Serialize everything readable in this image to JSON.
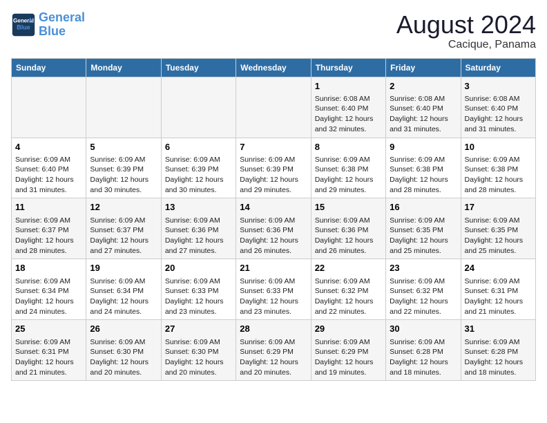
{
  "header": {
    "logo_line1": "General",
    "logo_line2": "Blue",
    "main_title": "August 2024",
    "subtitle": "Cacique, Panama"
  },
  "days_of_week": [
    "Sunday",
    "Monday",
    "Tuesday",
    "Wednesday",
    "Thursday",
    "Friday",
    "Saturday"
  ],
  "weeks": [
    [
      {
        "day": "",
        "detail": ""
      },
      {
        "day": "",
        "detail": ""
      },
      {
        "day": "",
        "detail": ""
      },
      {
        "day": "",
        "detail": ""
      },
      {
        "day": "1",
        "detail": "Sunrise: 6:08 AM\nSunset: 6:40 PM\nDaylight: 12 hours\nand 32 minutes."
      },
      {
        "day": "2",
        "detail": "Sunrise: 6:08 AM\nSunset: 6:40 PM\nDaylight: 12 hours\nand 31 minutes."
      },
      {
        "day": "3",
        "detail": "Sunrise: 6:08 AM\nSunset: 6:40 PM\nDaylight: 12 hours\nand 31 minutes."
      }
    ],
    [
      {
        "day": "4",
        "detail": "Sunrise: 6:09 AM\nSunset: 6:40 PM\nDaylight: 12 hours\nand 31 minutes."
      },
      {
        "day": "5",
        "detail": "Sunrise: 6:09 AM\nSunset: 6:39 PM\nDaylight: 12 hours\nand 30 minutes."
      },
      {
        "day": "6",
        "detail": "Sunrise: 6:09 AM\nSunset: 6:39 PM\nDaylight: 12 hours\nand 30 minutes."
      },
      {
        "day": "7",
        "detail": "Sunrise: 6:09 AM\nSunset: 6:39 PM\nDaylight: 12 hours\nand 29 minutes."
      },
      {
        "day": "8",
        "detail": "Sunrise: 6:09 AM\nSunset: 6:38 PM\nDaylight: 12 hours\nand 29 minutes."
      },
      {
        "day": "9",
        "detail": "Sunrise: 6:09 AM\nSunset: 6:38 PM\nDaylight: 12 hours\nand 28 minutes."
      },
      {
        "day": "10",
        "detail": "Sunrise: 6:09 AM\nSunset: 6:38 PM\nDaylight: 12 hours\nand 28 minutes."
      }
    ],
    [
      {
        "day": "11",
        "detail": "Sunrise: 6:09 AM\nSunset: 6:37 PM\nDaylight: 12 hours\nand 28 minutes."
      },
      {
        "day": "12",
        "detail": "Sunrise: 6:09 AM\nSunset: 6:37 PM\nDaylight: 12 hours\nand 27 minutes."
      },
      {
        "day": "13",
        "detail": "Sunrise: 6:09 AM\nSunset: 6:36 PM\nDaylight: 12 hours\nand 27 minutes."
      },
      {
        "day": "14",
        "detail": "Sunrise: 6:09 AM\nSunset: 6:36 PM\nDaylight: 12 hours\nand 26 minutes."
      },
      {
        "day": "15",
        "detail": "Sunrise: 6:09 AM\nSunset: 6:36 PM\nDaylight: 12 hours\nand 26 minutes."
      },
      {
        "day": "16",
        "detail": "Sunrise: 6:09 AM\nSunset: 6:35 PM\nDaylight: 12 hours\nand 25 minutes."
      },
      {
        "day": "17",
        "detail": "Sunrise: 6:09 AM\nSunset: 6:35 PM\nDaylight: 12 hours\nand 25 minutes."
      }
    ],
    [
      {
        "day": "18",
        "detail": "Sunrise: 6:09 AM\nSunset: 6:34 PM\nDaylight: 12 hours\nand 24 minutes."
      },
      {
        "day": "19",
        "detail": "Sunrise: 6:09 AM\nSunset: 6:34 PM\nDaylight: 12 hours\nand 24 minutes."
      },
      {
        "day": "20",
        "detail": "Sunrise: 6:09 AM\nSunset: 6:33 PM\nDaylight: 12 hours\nand 23 minutes."
      },
      {
        "day": "21",
        "detail": "Sunrise: 6:09 AM\nSunset: 6:33 PM\nDaylight: 12 hours\nand 23 minutes."
      },
      {
        "day": "22",
        "detail": "Sunrise: 6:09 AM\nSunset: 6:32 PM\nDaylight: 12 hours\nand 22 minutes."
      },
      {
        "day": "23",
        "detail": "Sunrise: 6:09 AM\nSunset: 6:32 PM\nDaylight: 12 hours\nand 22 minutes."
      },
      {
        "day": "24",
        "detail": "Sunrise: 6:09 AM\nSunset: 6:31 PM\nDaylight: 12 hours\nand 21 minutes."
      }
    ],
    [
      {
        "day": "25",
        "detail": "Sunrise: 6:09 AM\nSunset: 6:31 PM\nDaylight: 12 hours\nand 21 minutes."
      },
      {
        "day": "26",
        "detail": "Sunrise: 6:09 AM\nSunset: 6:30 PM\nDaylight: 12 hours\nand 20 minutes."
      },
      {
        "day": "27",
        "detail": "Sunrise: 6:09 AM\nSunset: 6:30 PM\nDaylight: 12 hours\nand 20 minutes."
      },
      {
        "day": "28",
        "detail": "Sunrise: 6:09 AM\nSunset: 6:29 PM\nDaylight: 12 hours\nand 20 minutes."
      },
      {
        "day": "29",
        "detail": "Sunrise: 6:09 AM\nSunset: 6:29 PM\nDaylight: 12 hours\nand 19 minutes."
      },
      {
        "day": "30",
        "detail": "Sunrise: 6:09 AM\nSunset: 6:28 PM\nDaylight: 12 hours\nand 18 minutes."
      },
      {
        "day": "31",
        "detail": "Sunrise: 6:09 AM\nSunset: 6:28 PM\nDaylight: 12 hours\nand 18 minutes."
      }
    ]
  ]
}
